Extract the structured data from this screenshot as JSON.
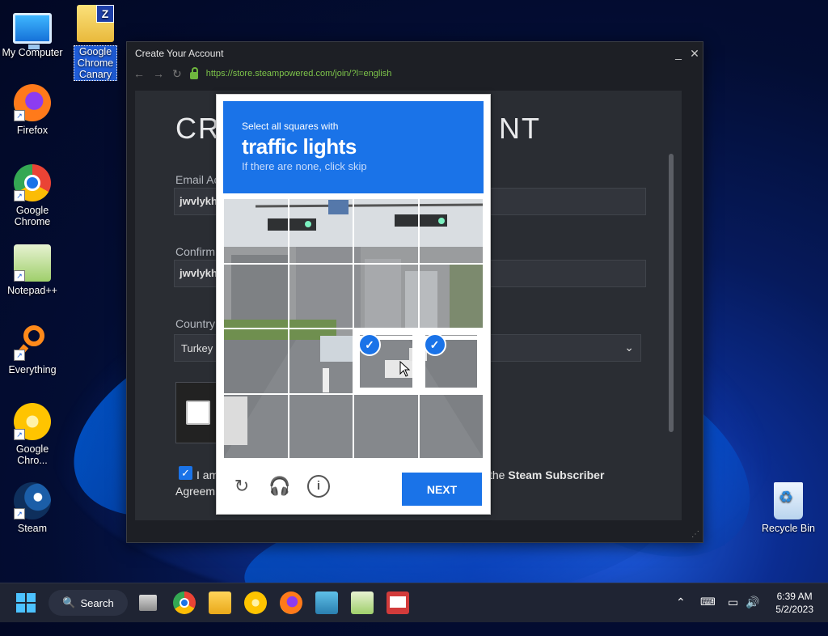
{
  "desktop": {
    "icons": [
      {
        "label": "My Computer"
      },
      {
        "label": "Google Chrome Canary"
      },
      {
        "label": "Firefox"
      },
      {
        "label": "Google Chrome"
      },
      {
        "label": "Notepad++"
      },
      {
        "label": "Everything"
      },
      {
        "label": "Google Chro..."
      },
      {
        "label": "Steam"
      },
      {
        "label": "Recycle Bin"
      }
    ]
  },
  "window": {
    "title": "Create Your Account",
    "url": "https://store.steampowered.com/join/?l=english",
    "minimize": "_",
    "close": "✕"
  },
  "form": {
    "title_start": "CR",
    "title_end": "NT",
    "email_label": "Email Ac",
    "email_value": "jwvlykh",
    "confirm_label": "Confirm",
    "confirm_value": "jwvlykh",
    "country_label": "Country",
    "country_value": "Turkey",
    "agree_start": "I am",
    "agree_tail_pre": "the ",
    "agree_tail_bold": "Steam Subscriber",
    "agree_line2": "Agreem"
  },
  "captcha": {
    "instruction": "Select all squares with",
    "target": "traffic lights",
    "hint": "If there are none, click skip",
    "next_label": "NEXT",
    "selected_tiles": [
      10,
      11
    ]
  },
  "taskbar": {
    "search_label": "Search",
    "time": "6:39 AM",
    "date": "5/2/2023"
  }
}
